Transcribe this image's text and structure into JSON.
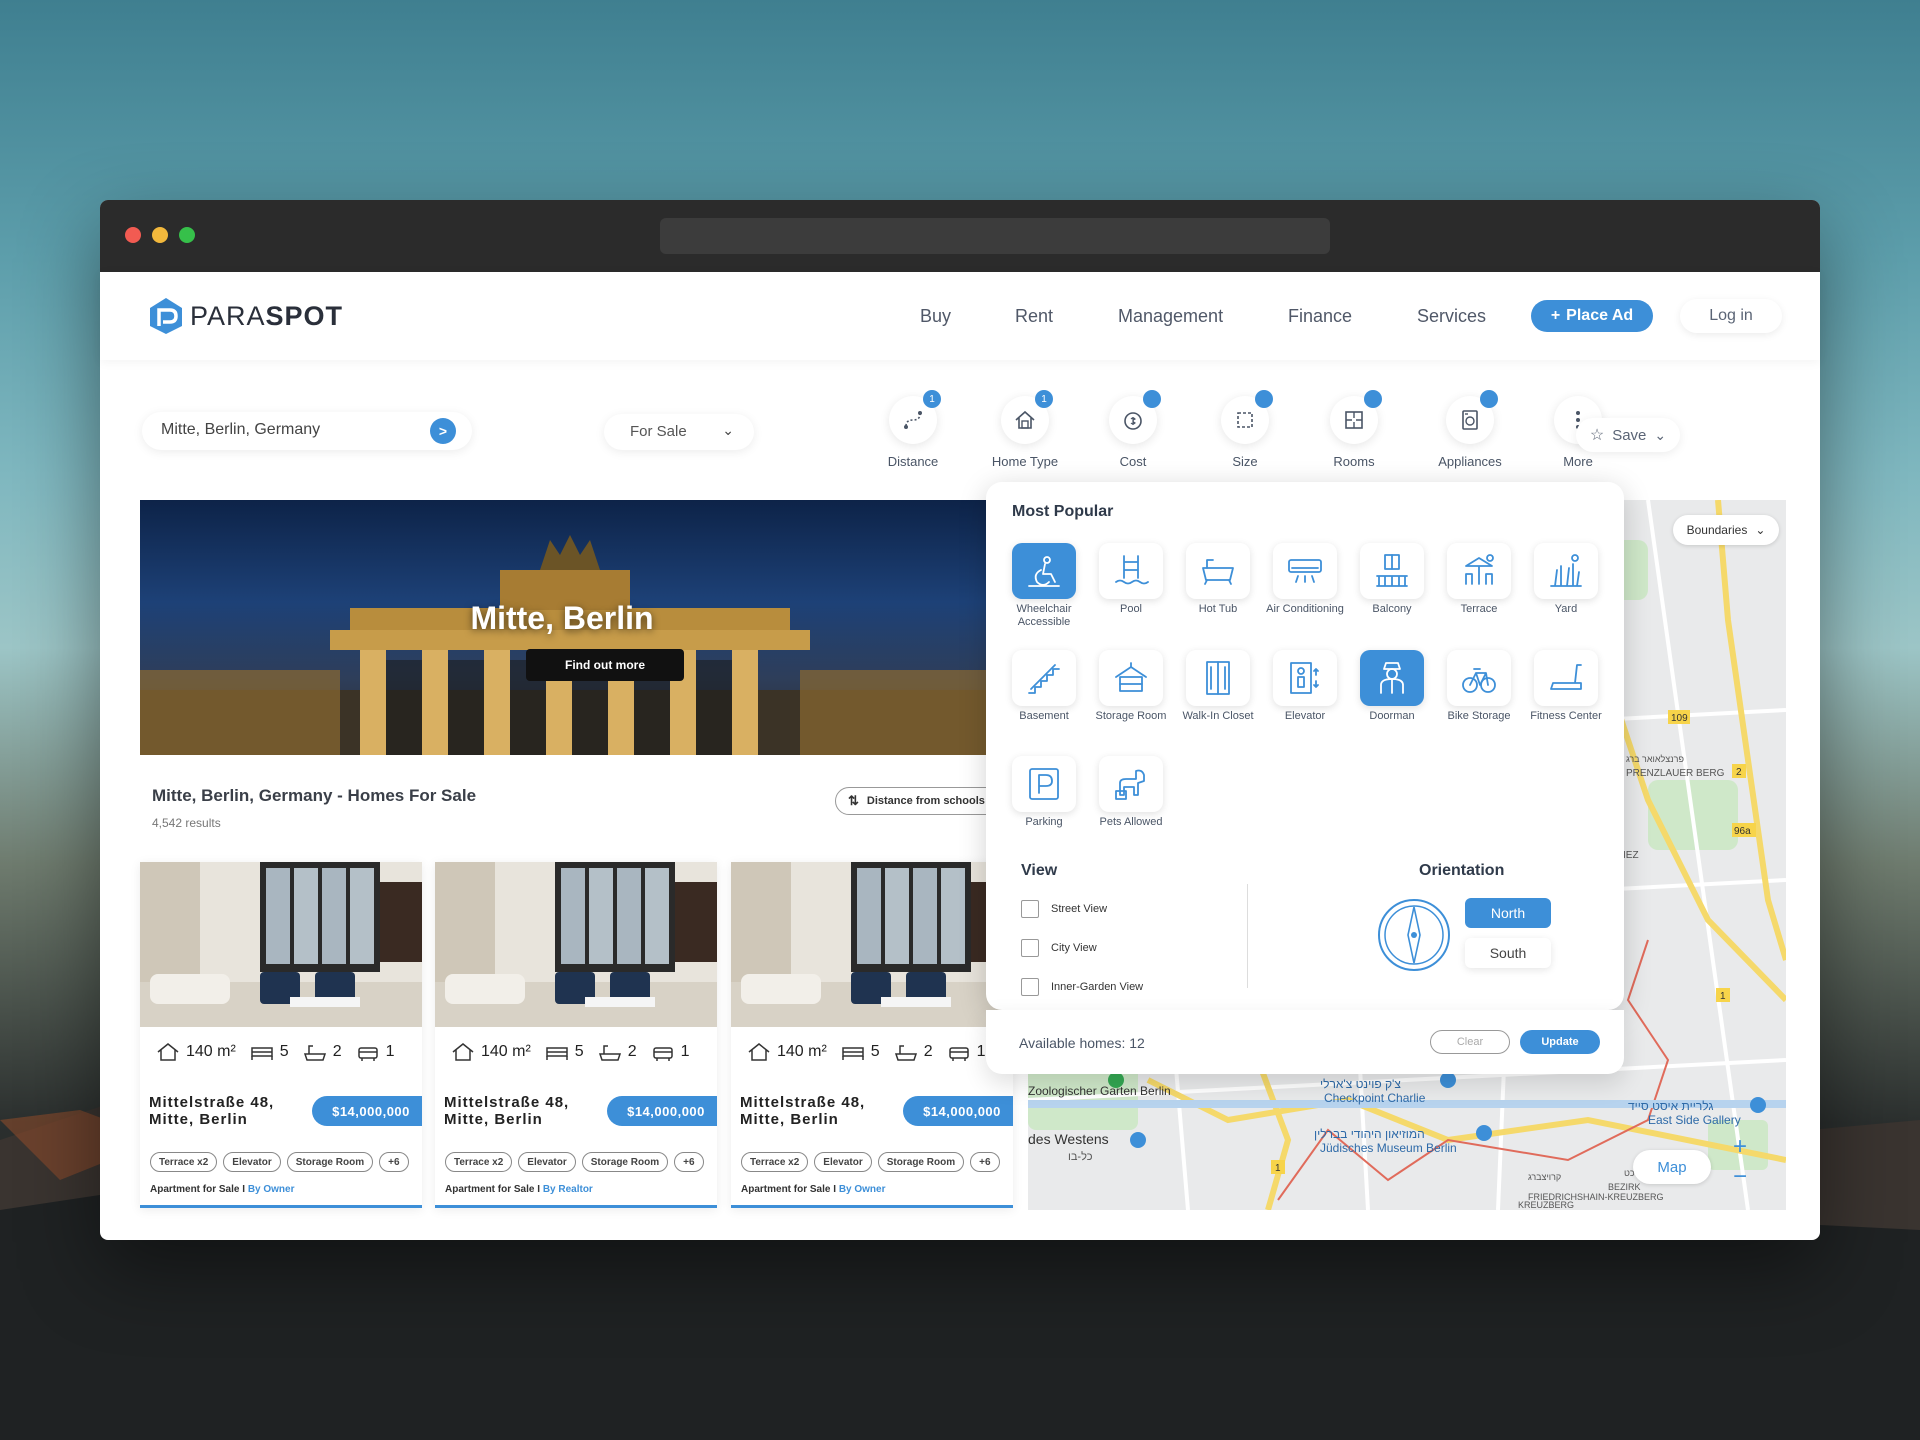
{
  "brand": {
    "name_light": "PARA",
    "name_bold": "SPOT"
  },
  "nav": {
    "links": [
      "Buy",
      "Rent",
      "Management",
      "Finance",
      "Services"
    ],
    "place_ad": "Place Ad",
    "place_ad_icon": "+",
    "login": "Log in"
  },
  "search": {
    "value": "Mitte, Berlin, Germany",
    "go_icon": ">"
  },
  "listing_type": {
    "selected": "For Sale"
  },
  "filters": [
    {
      "label": "Distance",
      "badge": "1",
      "icon": "route-icon"
    },
    {
      "label": "Home Type",
      "badge": "1",
      "icon": "house-icon"
    },
    {
      "label": "Cost",
      "badge": "",
      "icon": "coin-icon"
    },
    {
      "label": "Size",
      "badge": "",
      "icon": "area-icon"
    },
    {
      "label": "Rooms",
      "badge": "",
      "icon": "floorplan-icon"
    },
    {
      "label": "Appliances",
      "badge": "",
      "icon": "washer-icon"
    },
    {
      "label": "More",
      "icon": "kebab-icon"
    }
  ],
  "save": {
    "label": "Save"
  },
  "hero": {
    "title": "Mitte, Berlin",
    "button": "Find out more"
  },
  "results": {
    "title": "Mitte, Berlin, Germany - Homes For Sale",
    "count": "4,542 results",
    "sort_label": "Distance from schools"
  },
  "cards": [
    {
      "area": "140 m²",
      "beds": "5",
      "baths": "2",
      "parking": "1",
      "address": "Mittelstraße 48, Mitte, Berlin",
      "price": "$14,000,000",
      "tags": [
        "Terrace x2",
        "Elevator",
        "Storage Room",
        "+6"
      ],
      "type": "Apartment for Sale I",
      "by": "By Owner"
    },
    {
      "area": "140 m²",
      "beds": "5",
      "baths": "2",
      "parking": "1",
      "address": "Mittelstraße 48, Mitte, Berlin",
      "price": "$14,000,000",
      "tags": [
        "Terrace x2",
        "Elevator",
        "Storage Room",
        "+6"
      ],
      "type": "Apartment for Sale I",
      "by": "By Realtor"
    },
    {
      "area": "140 m²",
      "beds": "5",
      "baths": "2",
      "parking": "1",
      "address": "Mittelstraße 48, Mitte, Berlin",
      "price": "$14,000,000",
      "tags": [
        "Terrace x2",
        "Elevator",
        "Storage Room",
        "+6"
      ],
      "type": "Apartment for Sale I",
      "by": "By Owner"
    }
  ],
  "map": {
    "boundaries": "Boundaries",
    "map_button": "Map",
    "zoom_in": "+",
    "zoom_out": "−",
    "labels": {
      "zoo": "Zoologischer Garten Berlin",
      "checkpoint_he": "צ'ק פוינט צ'ארלי",
      "checkpoint": "Checkpoint Charlie",
      "museum_he": "המוזיאון היהודי בברלין",
      "museum": "Jüdisches Museum Berlin",
      "westens": "des Westens",
      "westens_he": "כל-בו",
      "gallery_he": "גלריית איסט סייד",
      "gallery": "East Side Gallery",
      "prenzlauer_he": "פרנצלאואר ברג",
      "prenzlauer": "PRENZLAUER BERG",
      "kreuzberg": "FRIEDRICHSHAIN-KREUZBERG",
      "bezirk": "BEZIRK",
      "kreuzberg2": "KREUZBERG",
      "kreuzberg_he": "קרויצברג",
      "kreuzberg_he2": "כט",
      "iez": "IEZ",
      "road_109": "109",
      "road_2": "2",
      "road_96a": "96a",
      "road_1a": "1",
      "road_1b": "1"
    }
  },
  "more_panel": {
    "most_popular": "Most Popular",
    "amenities": [
      {
        "label": "Wheelchair Accessible",
        "icon": "wheelchair-icon",
        "active": true
      },
      {
        "label": "Pool",
        "icon": "pool-icon",
        "active": false
      },
      {
        "label": "Hot Tub",
        "icon": "bathtub-icon",
        "active": false
      },
      {
        "label": "Air Conditioning",
        "icon": "air-conditioner-icon",
        "active": false
      },
      {
        "label": "Balcony",
        "icon": "balcony-icon",
        "active": false
      },
      {
        "label": "Terrace",
        "icon": "terrace-icon",
        "active": false
      },
      {
        "label": "Yard",
        "icon": "yard-icon",
        "active": false
      },
      {
        "label": "Basement",
        "icon": "stairs-icon",
        "active": false
      },
      {
        "label": "Storage Room",
        "icon": "storage-icon",
        "active": false
      },
      {
        "label": "Walk-In Closet",
        "icon": "closet-icon",
        "active": false
      },
      {
        "label": "Elevator",
        "icon": "elevator-icon",
        "active": false
      },
      {
        "label": "Doorman",
        "icon": "doorman-icon",
        "active": true
      },
      {
        "label": "Bike Storage",
        "icon": "bike-icon",
        "active": false
      },
      {
        "label": "Fitness Center",
        "icon": "treadmill-icon",
        "active": false
      },
      {
        "label": "Parking",
        "icon": "parking-icon",
        "active": false
      },
      {
        "label": "Pets Allowed",
        "icon": "dog-icon",
        "active": false
      }
    ],
    "view_title": "View",
    "views": [
      "Street View",
      "City View",
      "Inner-Garden View"
    ],
    "orientation_title": "Orientation",
    "orientations": [
      "North",
      "South"
    ],
    "available": "Available homes: 12",
    "clear": "Clear",
    "update": "Update"
  },
  "colors": {
    "accent": "#3d8fd8",
    "titlebar": "#2b2b2b",
    "text": "#3a3f48"
  }
}
